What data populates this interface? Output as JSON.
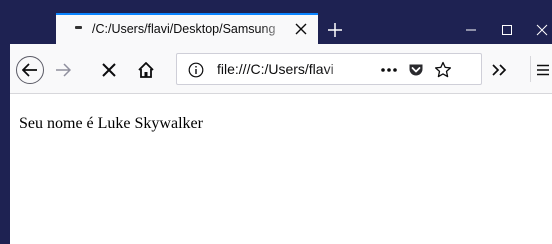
{
  "window": {
    "tab_title": "/C:/Users/flavi/Desktop/Samsung",
    "new_tab_label": "+",
    "controls": {
      "minimize_icon": "minimize-icon",
      "maximize_icon": "maximize-icon",
      "close_icon": "close-icon"
    }
  },
  "toolbar": {
    "url": "file:///C:/Users/flavi",
    "icons": [
      "back-arrow-icon",
      "forward-arrow-icon",
      "stop-icon",
      "home-icon",
      "info-icon",
      "more-icon",
      "pocket-icon",
      "bookmark-star-icon",
      "overflow-chevrons-icon",
      "menu-icon"
    ]
  },
  "page": {
    "text": "Seu nome é Luke Skywalker"
  },
  "colors": {
    "titlebar": "#1e2252",
    "tab_accent": "#0a84ff",
    "toolbar": "#f9f9fa"
  }
}
